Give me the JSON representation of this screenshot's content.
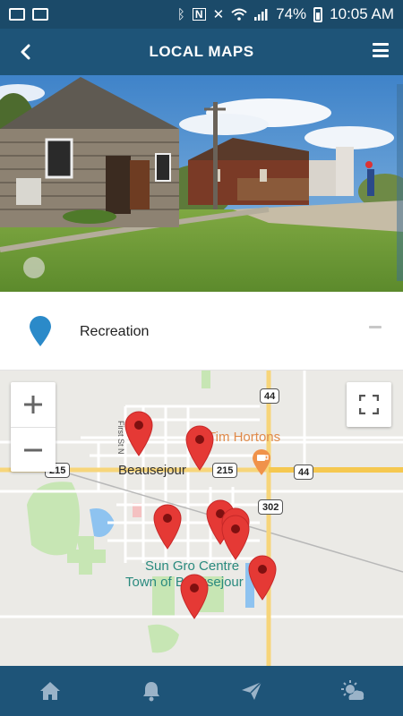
{
  "status_bar": {
    "battery": "74%",
    "time": "10:05 AM",
    "nfc": "N"
  },
  "app_bar": {
    "title": "LOCAL MAPS",
    "back_icon": "chevron-left-icon",
    "menu_icon": "hamburger-menu-icon"
  },
  "category": {
    "label": "Recreation",
    "pin_color": "#2b8ac9",
    "collapse_icon": "minus-icon"
  },
  "map": {
    "labels": {
      "town": "Beausejour",
      "poi": "Tim Hortons",
      "park_line1": "Sun Gro Centre",
      "park_line2": "Town of Beausejour",
      "street": "First St N"
    },
    "shields": {
      "hwy44_top": "44",
      "hwy44_right": "44",
      "hwy215_left": "215",
      "hwy215_mid": "215",
      "hwy302": "302"
    },
    "marker_color": "#e53935",
    "marker_count": 8
  },
  "colors": {
    "status_bar": "#1b4a69",
    "app_bar": "#1e5478",
    "bottom_nav": "#1e5478"
  },
  "bottom_nav": [
    {
      "icon": "home-icon"
    },
    {
      "icon": "bell-icon"
    },
    {
      "icon": "send-icon"
    },
    {
      "icon": "weather-icon"
    }
  ]
}
